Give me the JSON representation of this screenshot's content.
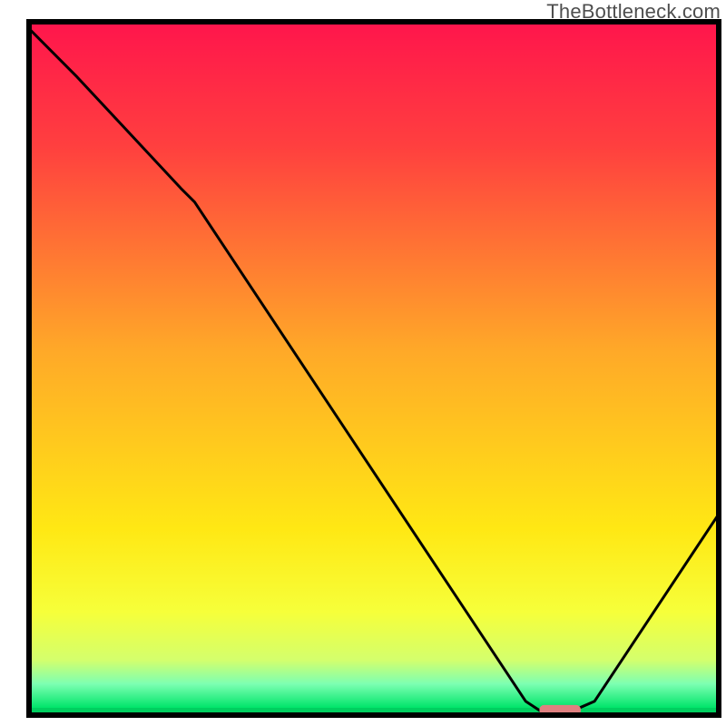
{
  "watermark": "TheBottleneck.com",
  "chart_data": {
    "type": "line",
    "title": "",
    "xlabel": "",
    "ylabel": "",
    "xlim": [
      0,
      100
    ],
    "ylim": [
      0,
      100
    ],
    "x": [
      0,
      7,
      22,
      24,
      72,
      74,
      79,
      82,
      100
    ],
    "values": [
      99,
      92,
      76,
      74,
      2,
      0.7,
      0.7,
      2,
      29
    ],
    "marker": {
      "x_start": 74,
      "x_end": 80,
      "y": 0.8
    },
    "gradient_stops": [
      {
        "pos": 0.0,
        "color": "#ff154c"
      },
      {
        "pos": 0.18,
        "color": "#ff3f3f"
      },
      {
        "pos": 0.48,
        "color": "#ffa928"
      },
      {
        "pos": 0.74,
        "color": "#ffe814"
      },
      {
        "pos": 0.86,
        "color": "#f6ff3a"
      },
      {
        "pos": 0.93,
        "color": "#d4ff6c"
      },
      {
        "pos": 0.965,
        "color": "#7dffb2"
      },
      {
        "pos": 1.0,
        "color": "#00e56a"
      }
    ]
  }
}
